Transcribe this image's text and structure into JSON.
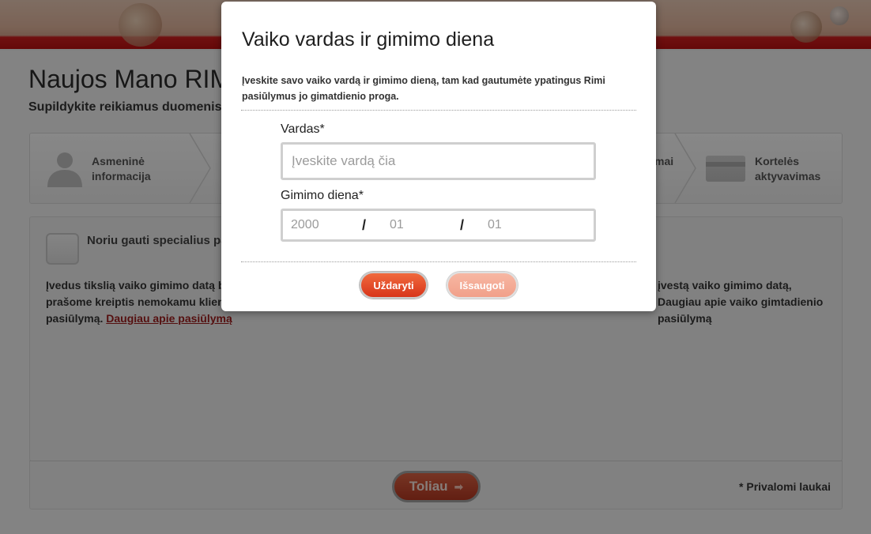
{
  "page": {
    "title": "Naujos Mano RIMI",
    "subtitle": "Supildykite reikiamus duomenis,",
    "steps": [
      {
        "label_line1": "Asmeninė",
        "label_line2": "informacija",
        "icon": "person-icon"
      },
      {
        "label_partial": "mai",
        "icon": ""
      },
      {
        "label_line1": "Kortelės",
        "label_line2": "aktyvavimas",
        "icon": "card-icon"
      }
    ],
    "checkbox_label": "Noriu gauti specialius pas",
    "paragraph_left_1": "Įvedus tikslią vaiko gimimo datą b",
    "paragraph_left_2": "prašome kreiptis nemokamu klien",
    "paragraph_left_3": "pasiūlymą.",
    "paragraph_left_link": "Daugiau apie pasiūlymą",
    "paragraph_right_1": "įvestą vaiko gimimo datą,",
    "paragraph_right_2": "Daugiau apie vaiko gimtadienio",
    "paragraph_right_3": "pasiūlymą",
    "next_button": "Toliau",
    "next_arrow": "➡",
    "required_note": "* Privalomi laukai"
  },
  "modal": {
    "title": "Vaiko vardas ir gimimo diena",
    "description": "Įveskite savo vaiko vardą ir gimimo dieną, tam kad gautumėte ypatingus Rimi pasiūlymus jo gimatdienio proga.",
    "name_label": "Vardas*",
    "name_placeholder": "Įveskite vardą čia",
    "birth_label": "Gimimo diena*",
    "year_value": "2000",
    "month_value": "01",
    "day_value": "01",
    "slash": "/",
    "close_button": "Uždaryti",
    "save_button": "Išsaugoti"
  },
  "colors": {
    "accent_red": "#d8351a",
    "header_red": "#cc1f1f",
    "link": "#9b1d1d"
  }
}
